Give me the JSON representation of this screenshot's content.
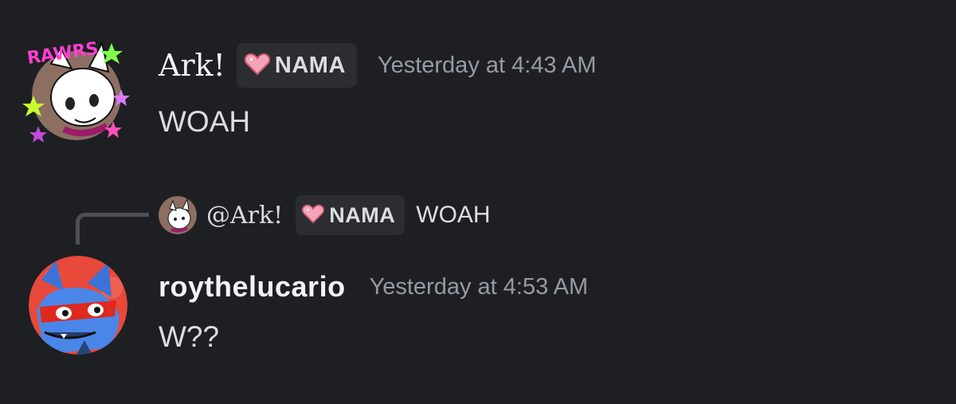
{
  "messages": [
    {
      "username": "Ark!",
      "tag_icon": "heart-icon",
      "tag": "NAMA",
      "timestamp": "Yesterday at 4:43 AM",
      "text": "WOAH",
      "avatar_logo_text": "RAWRS"
    },
    {
      "reply": {
        "username": "@Ark!",
        "tag_icon": "heart-icon",
        "tag": "NAMA",
        "text": "WOAH"
      },
      "username": "roythelucario",
      "timestamp": "Yesterday at 4:53 AM",
      "text": "W??"
    }
  ],
  "colors": {
    "background": "#1e1f22",
    "tag_background": "#2b2d31",
    "timestamp": "#949ba4",
    "text": "#dbdee1",
    "heart": "#f4a4b8"
  }
}
